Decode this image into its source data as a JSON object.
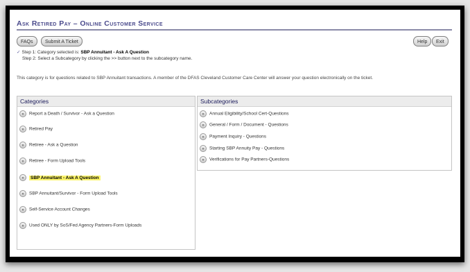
{
  "header": {
    "title": "Ask Retired Pay – Online Customer Service"
  },
  "toolbar": {
    "faqs": "FAQs",
    "submit": "Submit A Ticket",
    "help": "Help",
    "exit": "Exit"
  },
  "steps": {
    "step1_prefix": "Step 1: Category selected is:",
    "step1_value": "SBP Annuitant - Ask A Question",
    "step2": "Step 2: Select a Subcategory by clicking the >> button next to the subcategory name."
  },
  "description": "This category is for questions related to SBP Annuitant transactions. A member of the DFAS Cleveland Customer Care Center will answer your question electronically on the ticket.",
  "categories": {
    "heading": "Categories",
    "items": [
      "Report a Death / Survivor - Ask a Question",
      "Retired Pay",
      "Retiree - Ask a Question",
      "Retiree - Form Upload Tools",
      "SBP Annuitant - Ask A Question",
      "SBP Annuitant/Survivor - Form Upload Tools",
      "Self-Service Account Changes",
      "Used ONLY by SoS/Fed Agency Partners-Form Uploads"
    ],
    "selected_index": 4
  },
  "subcategories": {
    "heading": "Subcategories",
    "items": [
      "Annual Eligibility/School Cert-Questions",
      "General / Form / Document - Questions",
      "Payment Inquiry - Questions",
      "Starting SBP Annuity Pay - Questions",
      "Verifications for Pay Partners-Questions"
    ]
  },
  "icons": {
    "arrow": "double-chevron-right-icon",
    "check": "checkmark-icon"
  },
  "colors": {
    "title": "#4a4a8c",
    "highlight": "#fbf46a",
    "heading": "#1a1a5a"
  }
}
